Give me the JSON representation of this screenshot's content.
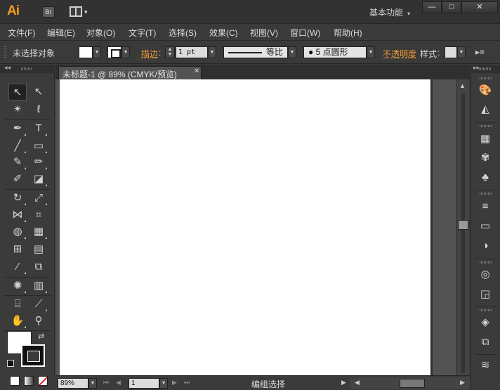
{
  "app": {
    "logo": "Ai",
    "bridge_label": "Br",
    "workspace_label": "基本功能",
    "window_controls": {
      "minimize": "—",
      "maximize": "□",
      "close": "✕"
    }
  },
  "menu": {
    "items": [
      "文件(F)",
      "编辑(E)",
      "对象(O)",
      "文字(T)",
      "选择(S)",
      "效果(C)",
      "视图(V)",
      "窗口(W)",
      "帮助(H)"
    ]
  },
  "control_bar": {
    "selection_status": "未选择对象",
    "stroke_label": "描边",
    "stroke_weight": "1 pt",
    "line_profile": "等比",
    "brush": "● 5 点圆形",
    "opacity_label": "不透明度",
    "style_label": "样式"
  },
  "document": {
    "tab_title": "未标题-1 @ 89% (CMYK/预览)",
    "zoom_value": "89%",
    "page_value": "1",
    "status_text": "编组选择"
  },
  "tools": [
    {
      "name": "selection-tool",
      "glyph": "↖"
    },
    {
      "name": "direct-selection-tool",
      "glyph": "↖"
    },
    {
      "name": "magic-wand-tool",
      "glyph": "✴"
    },
    {
      "name": "lasso-tool",
      "glyph": "ℓ"
    },
    {
      "name": "pen-tool",
      "glyph": "✒"
    },
    {
      "name": "type-tool",
      "glyph": "T"
    },
    {
      "name": "line-segment-tool",
      "glyph": "╱"
    },
    {
      "name": "rectangle-tool",
      "glyph": "▭"
    },
    {
      "name": "paintbrush-tool",
      "glyph": "✎"
    },
    {
      "name": "pencil-tool",
      "glyph": "✏"
    },
    {
      "name": "blob-brush-tool",
      "glyph": "✐"
    },
    {
      "name": "eraser-tool",
      "glyph": "◪"
    },
    {
      "name": "rotate-tool",
      "glyph": "↻"
    },
    {
      "name": "scale-tool",
      "glyph": "⤢"
    },
    {
      "name": "width-tool",
      "glyph": "⋈"
    },
    {
      "name": "free-transform-tool",
      "glyph": "⌗"
    },
    {
      "name": "shape-builder-tool",
      "glyph": "◍"
    },
    {
      "name": "perspective-grid-tool",
      "glyph": "▦"
    },
    {
      "name": "mesh-tool",
      "glyph": "⊞"
    },
    {
      "name": "gradient-tool",
      "glyph": "▤"
    },
    {
      "name": "eyedropper-tool",
      "glyph": "⁄"
    },
    {
      "name": "blend-tool",
      "glyph": "⧉"
    },
    {
      "name": "symbol-sprayer-tool",
      "glyph": "✺"
    },
    {
      "name": "column-graph-tool",
      "glyph": "▥"
    },
    {
      "name": "artboard-tool",
      "glyph": "⌸"
    },
    {
      "name": "slice-tool",
      "glyph": "⟋"
    },
    {
      "name": "hand-tool",
      "glyph": "✋"
    },
    {
      "name": "zoom-tool",
      "glyph": "⚲"
    }
  ],
  "dock": [
    {
      "name": "color-panel-icon",
      "glyph": "🎨"
    },
    {
      "name": "color-guide-panel-icon",
      "glyph": "◭"
    },
    {
      "name": "swatches-panel-icon",
      "glyph": "▦"
    },
    {
      "name": "brushes-panel-icon",
      "glyph": "✾"
    },
    {
      "name": "symbols-panel-icon",
      "glyph": "♣"
    },
    {
      "name": "stroke-panel-icon",
      "glyph": "≡"
    },
    {
      "name": "gradient-panel-icon",
      "glyph": "▭"
    },
    {
      "name": "transparency-panel-icon",
      "glyph": "◑"
    },
    {
      "name": "appearance-panel-icon",
      "glyph": "◎"
    },
    {
      "name": "graphic-styles-panel-icon",
      "glyph": "◲"
    },
    {
      "name": "layers-panel-icon",
      "glyph": "◈"
    },
    {
      "name": "artboards-panel-icon",
      "glyph": "⧉"
    },
    {
      "name": "layers-stack-panel-icon",
      "glyph": "≋"
    }
  ],
  "colors": {
    "accent_orange": "#f09b33",
    "ui_bg": "#3b3b3b",
    "canvas_bg": "#535353",
    "artboard": "#ffffff"
  }
}
